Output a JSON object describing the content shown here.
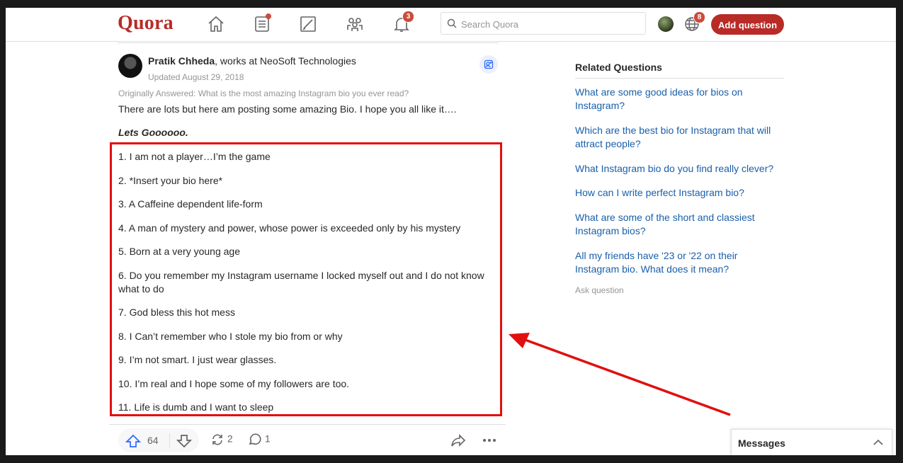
{
  "header": {
    "logo": "Quora",
    "nav": [
      {
        "name": "home-icon"
      },
      {
        "name": "answer-list-icon",
        "dot": true
      },
      {
        "name": "pencil-icon"
      },
      {
        "name": "spaces-icon"
      },
      {
        "name": "bell-icon",
        "badge": "3"
      }
    ],
    "search_placeholder": "Search Quora",
    "language_badge": "8",
    "add_question": "Add question",
    "brand_color": "#b92b27"
  },
  "answer": {
    "author_name": "Pratik Chheda",
    "author_credential": ", works at NeoSoft Technologies",
    "updated": "Updated August 29, 2018",
    "originally_answered": "Originally Answered: What is the most amazing Instagram bio you ever read?",
    "intro": "There are lots but here am posting some amazing Bio. I hope you all like it….",
    "lets_go": "Lets Goooooo.",
    "bios": [
      "1. I am not a player…I’m the game",
      "2. *Insert your bio here*",
      "3. A Caffeine dependent life-form",
      "4. A man of mystery and power, whose power is exceeded only by his mystery",
      "5. Born at a very young age",
      "6. Do you remember my Instagram username I locked myself out and I do not know what to do",
      "7. God bless this hot mess",
      "8. I Can’t remember who I stole my bio from or why",
      "9. I’m not smart. I just wear glasses.",
      "10. I’m real and I hope some of my followers are too.",
      "11. Life is dumb and I want to sleep"
    ],
    "upvotes": "64",
    "shares": "2",
    "comments": "1",
    "highlight_color": "#e10f0f"
  },
  "related": {
    "title": "Related Questions",
    "questions": [
      "What are some good ideas for bios on Instagram?",
      "Which are the best bio for Instagram that will attract people?",
      "What Instagram bio do you find really clever?",
      "How can I write perfect Instagram bio?",
      "What are some of the short and classiest Instagram bios?",
      "All my friends have '23 or '22 on their Instagram bio. What does it mean?"
    ],
    "ask_question": "Ask question"
  },
  "messages": {
    "label": "Messages"
  }
}
